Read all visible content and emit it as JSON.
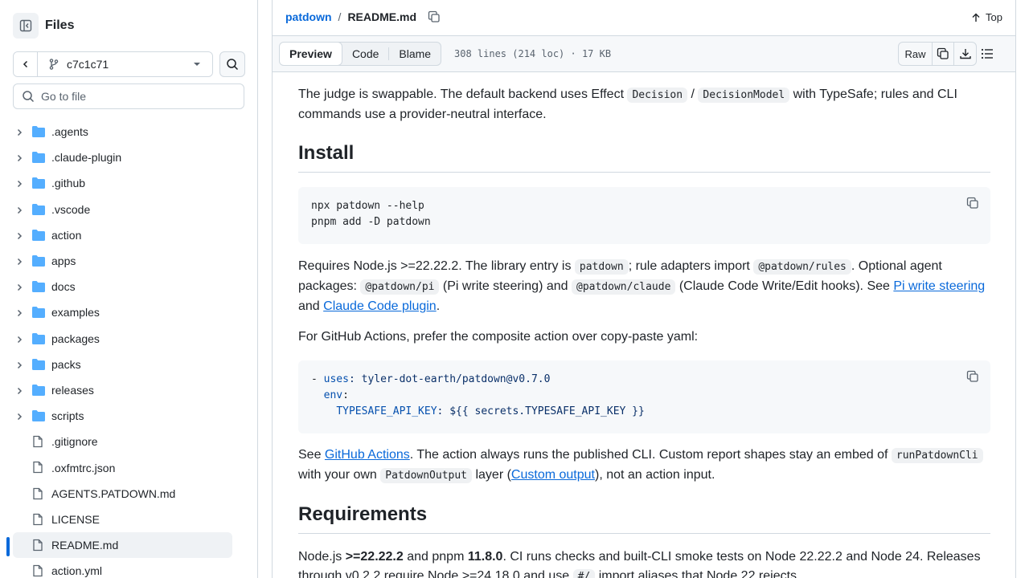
{
  "sidebar": {
    "title": "Files",
    "branch": "c7c1c71",
    "goto_placeholder": "Go to file",
    "items": [
      {
        "label": ".agents",
        "type": "folder"
      },
      {
        "label": ".claude-plugin",
        "type": "folder"
      },
      {
        "label": ".github",
        "type": "folder"
      },
      {
        "label": ".vscode",
        "type": "folder"
      },
      {
        "label": "action",
        "type": "folder"
      },
      {
        "label": "apps",
        "type": "folder"
      },
      {
        "label": "docs",
        "type": "folder"
      },
      {
        "label": "examples",
        "type": "folder"
      },
      {
        "label": "packages",
        "type": "folder"
      },
      {
        "label": "packs",
        "type": "folder"
      },
      {
        "label": "releases",
        "type": "folder"
      },
      {
        "label": "scripts",
        "type": "folder"
      },
      {
        "label": ".gitignore",
        "type": "file"
      },
      {
        "label": ".oxfmtrc.json",
        "type": "file"
      },
      {
        "label": "AGENTS.PATDOWN.md",
        "type": "file"
      },
      {
        "label": "LICENSE",
        "type": "file"
      },
      {
        "label": "README.md",
        "type": "file",
        "selected": true
      },
      {
        "label": "action.yml",
        "type": "file"
      }
    ]
  },
  "header": {
    "repo": "patdown",
    "separator": "/",
    "file": "README.md",
    "top_label": "Top"
  },
  "toolbar": {
    "tabs": [
      "Preview",
      "Code",
      "Blame"
    ],
    "active_tab": "Preview",
    "meta": "308 lines (214 loc) · 17 KB",
    "raw_label": "Raw"
  },
  "content": {
    "p1_a": "The judge is swappable. The default backend uses Effect ",
    "p1_code1": "Decision",
    "p1_b": " / ",
    "p1_code2": "DecisionModel",
    "p1_c": " with TypeSafe; rules and CLI commands use a provider-neutral interface.",
    "h_install": "Install",
    "code1_line1": "npx patdown --help",
    "code1_line2": "pnpm add -D patdown",
    "p2_a": "Requires Node.js >=22.22.2. The library entry is ",
    "p2_code1": "patdown",
    "p2_b": "; rule adapters import ",
    "p2_code2": "@patdown/rules",
    "p2_c": ". Optional agent packages: ",
    "p2_code3": "@patdown/pi",
    "p2_d": " (Pi write steering) and ",
    "p2_code4": "@patdown/claude",
    "p2_e": " (Claude Code Write/Edit hooks). See ",
    "p2_link1": "Pi write steering",
    "p2_f": " and ",
    "p2_link2": "Claude Code plugin",
    "p2_g": ".",
    "p3": "For GitHub Actions, prefer the composite action over copy-paste yaml:",
    "code2_dash": "- ",
    "code2_uses": "uses",
    "code2_uses_val": ": tyler-dot-earth/patdown@v0.7.0",
    "code2_env": "env",
    "code2_env_colon": ":",
    "code2_key": "TYPESAFE_API_KEY",
    "code2_key_val": ": ${{ secrets.TYPESAFE_API_KEY }}",
    "p4_a": "See ",
    "p4_link1": "GitHub Actions",
    "p4_b": ". The action always runs the published CLI. Custom report shapes stay an embed of ",
    "p4_code1": "runPatdownCli",
    "p4_c": " with your own ",
    "p4_code2": "PatdownOutput",
    "p4_d": " layer (",
    "p4_link2": "Custom output",
    "p4_e": "), not an action input.",
    "h_requirements": "Requirements",
    "p5_a": "Node.js ",
    "p5_b1": ">=22.22.2",
    "p5_c": " and pnpm ",
    "p5_b2": "11.8.0",
    "p5_d": ". CI runs checks and built-CLI smoke tests on Node 22.22.2 and Node 24. Releases through v0.2.2 require Node >=24.18.0 and use ",
    "p5_code": "#/",
    "p5_e": " import aliases that Node 22 rejects."
  },
  "colors": {
    "accent": "#0969da",
    "folder": "#54aeff",
    "border": "#d1d9e0",
    "muted": "#59636e"
  },
  "icons": {
    "panel": "sidebar-collapse-icon",
    "branch": "git-branch-icon",
    "search": "search-icon",
    "folder": "folder-icon",
    "file": "file-icon",
    "copy": "copy-icon",
    "download": "download-icon",
    "list": "list-icon",
    "arrow_up": "arrow-up-icon"
  }
}
